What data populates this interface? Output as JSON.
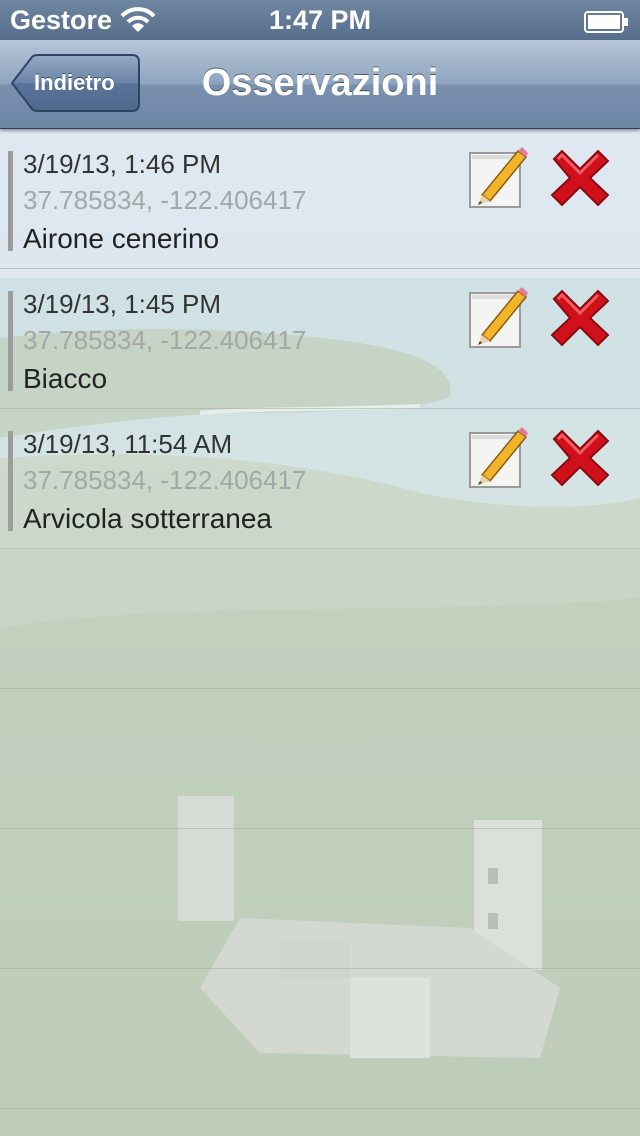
{
  "status_bar": {
    "carrier": "Gestore",
    "time": "1:47 PM",
    "wifi_icon": "wifi-icon",
    "battery_icon": "battery-icon"
  },
  "nav": {
    "back_label": "Indietro",
    "title": "Osservazioni"
  },
  "observations": [
    {
      "date": "3/19/13, 1:46 PM",
      "coords": "37.785834, -122.406417",
      "name": "Airone cenerino"
    },
    {
      "date": "3/19/13, 1:45 PM",
      "coords": "37.785834, -122.406417",
      "name": "Biacco"
    },
    {
      "date": "3/19/13, 11:54 AM",
      "coords": "37.785834, -122.406417",
      "name": "Arvicola sotterranea"
    }
  ],
  "icons": {
    "edit": "pencil-notepad-icon",
    "delete": "red-x-icon"
  },
  "colors": {
    "nav_bar": "#7d93b0",
    "status_bar": "#5f7793",
    "delete_red": "#d0101a"
  }
}
